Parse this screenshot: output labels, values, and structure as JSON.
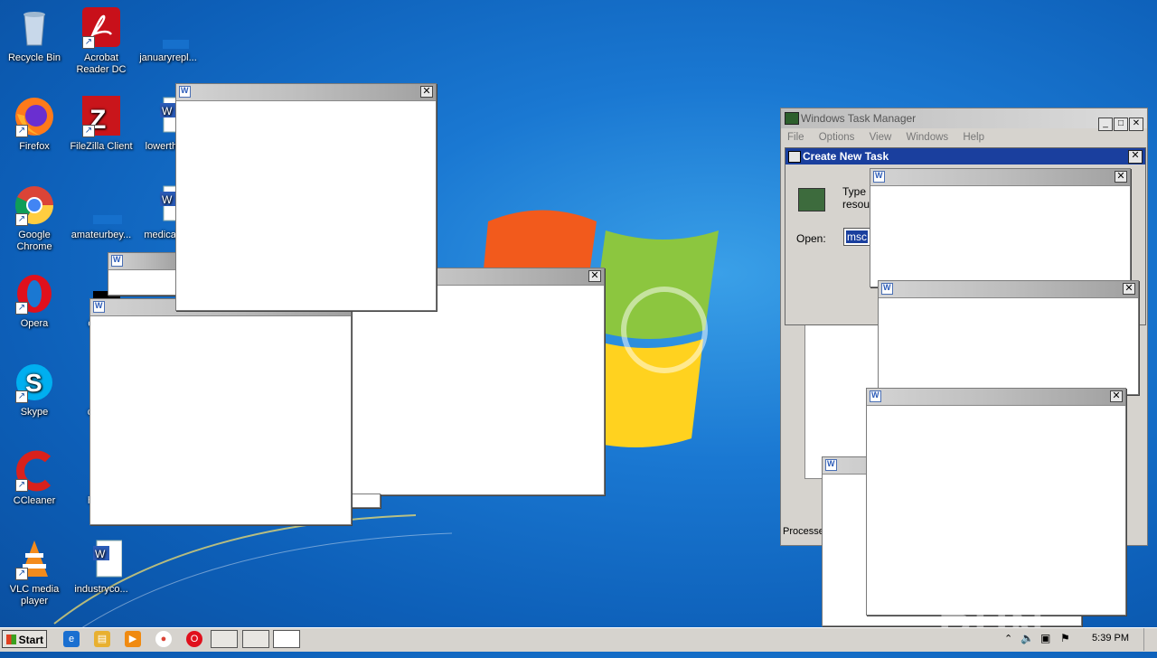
{
  "desktop": {
    "icons": [
      {
        "label": "Recycle Bin"
      },
      {
        "label": "Acrobat Reader DC"
      },
      {
        "label": "januaryrepl..."
      },
      {
        "label": "Firefox"
      },
      {
        "label": "FileZilla Client"
      },
      {
        "label": "lowerthe..."
      },
      {
        "label": "Google Chrome"
      },
      {
        "label": "amateurbey..."
      },
      {
        "label": "medicalb..."
      },
      {
        "label": "Opera"
      },
      {
        "label": "colo..."
      },
      {
        "label": "Skype"
      },
      {
        "label": "crea..."
      },
      {
        "label": "CCleaner"
      },
      {
        "label": "high..."
      },
      {
        "label": "VLC media player"
      },
      {
        "label": "industryco..."
      }
    ]
  },
  "task_manager": {
    "title": "Windows Task Manager",
    "menu": [
      "File",
      "Options",
      "View",
      "Windows",
      "Help"
    ],
    "status": "Processe"
  },
  "create_new_task": {
    "title": "Create New Task",
    "prompt_line1": "Type",
    "prompt_line2": "resou",
    "open_label": "Open:",
    "open_value": "msc"
  },
  "taskbar": {
    "start_label": "Start",
    "clock": "5:39 PM"
  },
  "watermark": "ANY RUN"
}
